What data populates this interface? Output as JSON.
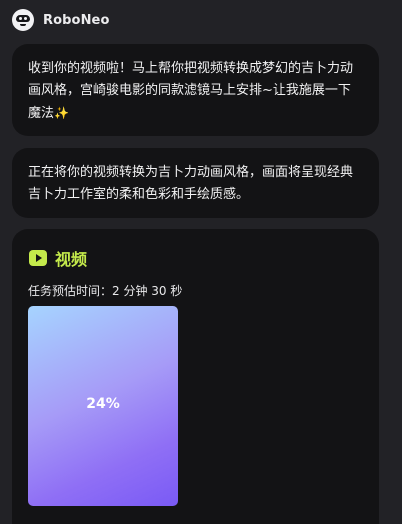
{
  "header": {
    "app_name": "RoboNeo",
    "avatar_icon": "roboneo-logo-icon"
  },
  "messages": [
    {
      "text": "收到你的视频啦！马上帮你把视频转换成梦幻的吉卜力动画风格，宫崎骏电影的同款滤镜马上安排~让我施展一下魔法",
      "emoji": "✨"
    },
    {
      "text": "正在将你的视频转换为吉卜力动画风格，画面将呈现经典吉卜力工作室的柔和色彩和手绘质感。"
    }
  ],
  "video_card": {
    "title": "视频",
    "icon": "video-play-icon",
    "eta": "任务预估时间：2 分钟 30 秒",
    "progress": "24%",
    "progress_value": 24
  },
  "colors": {
    "background": "#222226",
    "card": "#131315",
    "accent": "#c4ea4b"
  }
}
